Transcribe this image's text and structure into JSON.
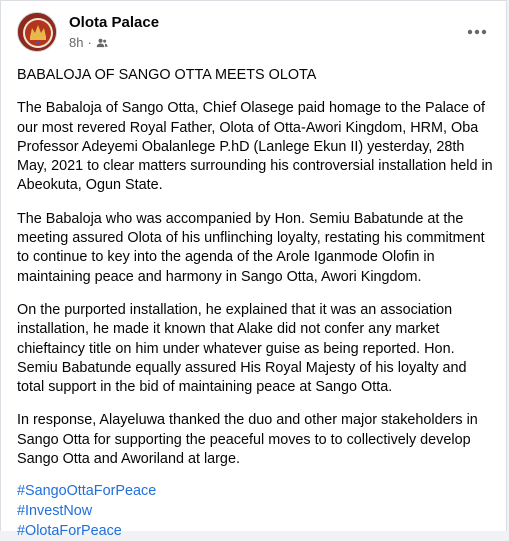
{
  "post": {
    "author": "Olota Palace",
    "time": "8h",
    "separator": "·",
    "audience_icon": "friends-icon",
    "more_icon": "more-dots-icon",
    "title": "BABALOJA OF SANGO OTTA MEETS OLOTA",
    "paragraphs": [
      "The Babaloja of Sango Otta, Chief Olasege paid homage to the Palace of our most revered Royal Father, Olota of Otta-Awori Kingdom, HRM, Oba Professor Adeyemi Obalanlege P.hD (Lanlege Ekun II) yesterday, 28th May, 2021 to clear matters surrounding his controversial installation held in Abeokuta, Ogun State.",
      "The Babaloja who was accompanied by Hon. Semiu Babatunde at the meeting assured Olota of his unflinching loyalty, restating his commitment to continue to key into the agenda of the Arole Iganmode Olofin in maintaining peace and harmony in Sango Otta, Awori Kingdom.",
      "On the purported installation, he explained that it was an association installation, he made it known that Alake did not confer any market chieftaincy title on him under whatever guise as being reported. Hon. Semiu Babatunde equally assured His Royal Majesty of his loyalty and total support in the bid of maintaining peace at Sango Otta.",
      "In response, Alayeluwa thanked the duo and other major stakeholders in Sango Otta for supporting the peaceful moves to to collectively develop Sango Otta and Aworiland at large."
    ],
    "hashtags": [
      "#SangoOttaForPeace",
      "#InvestNow",
      "#OlotaForPeace"
    ]
  },
  "colors": {
    "link": "#216fdb",
    "text": "#050505",
    "meta": "#65676b"
  }
}
